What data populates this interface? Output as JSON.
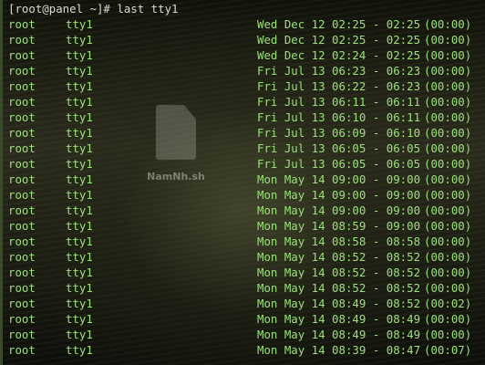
{
  "terminal": {
    "prompt": "[root@panel ~]# ",
    "command": "last tty1",
    "watermark": "NamNh.sh"
  },
  "rows": [
    {
      "user": "root",
      "tty": "tty1",
      "time": "Wed Dec 12 02:25 - 02:25",
      "duration": "(00:00)"
    },
    {
      "user": "root",
      "tty": "tty1",
      "time": "Wed Dec 12 02:25 - 02:25",
      "duration": "(00:00)"
    },
    {
      "user": "root",
      "tty": "tty1",
      "time": "Wed Dec 12 02:24 - 02:25",
      "duration": "(00:00)"
    },
    {
      "user": "root",
      "tty": "tty1",
      "time": "Fri Jul 13 06:23 - 06:23",
      "duration": "(00:00)"
    },
    {
      "user": "root",
      "tty": "tty1",
      "time": "Fri Jul 13 06:22 - 06:23",
      "duration": "(00:00)"
    },
    {
      "user": "root",
      "tty": "tty1",
      "time": "Fri Jul 13 06:11 - 06:11",
      "duration": "(00:00)"
    },
    {
      "user": "root",
      "tty": "tty1",
      "time": "Fri Jul 13 06:10 - 06:11",
      "duration": "(00:00)"
    },
    {
      "user": "root",
      "tty": "tty1",
      "time": "Fri Jul 13 06:09 - 06:10",
      "duration": "(00:00)"
    },
    {
      "user": "root",
      "tty": "tty1",
      "time": "Fri Jul 13 06:05 - 06:05",
      "duration": "(00:00)"
    },
    {
      "user": "root",
      "tty": "tty1",
      "time": "Fri Jul 13 06:05 - 06:05",
      "duration": "(00:00)"
    },
    {
      "user": "root",
      "tty": "tty1",
      "time": "Mon May 14 09:00 - 09:00",
      "duration": "(00:00)"
    },
    {
      "user": "root",
      "tty": "tty1",
      "time": "Mon May 14 09:00 - 09:00",
      "duration": "(00:00)"
    },
    {
      "user": "root",
      "tty": "tty1",
      "time": "Mon May 14 09:00 - 09:00",
      "duration": "(00:00)"
    },
    {
      "user": "root",
      "tty": "tty1",
      "time": "Mon May 14 08:59 - 09:00",
      "duration": "(00:00)"
    },
    {
      "user": "root",
      "tty": "tty1",
      "time": "Mon May 14 08:58 - 08:58",
      "duration": "(00:00)"
    },
    {
      "user": "root",
      "tty": "tty1",
      "time": "Mon May 14 08:52 - 08:52",
      "duration": "(00:00)"
    },
    {
      "user": "root",
      "tty": "tty1",
      "time": "Mon May 14 08:52 - 08:52",
      "duration": "(00:00)"
    },
    {
      "user": "root",
      "tty": "tty1",
      "time": "Mon May 14 08:52 - 08:52",
      "duration": "(00:00)"
    },
    {
      "user": "root",
      "tty": "tty1",
      "time": "Mon May 14 08:49 - 08:52",
      "duration": "(00:02)"
    },
    {
      "user": "root",
      "tty": "tty1",
      "time": "Mon May 14 08:49 - 08:49",
      "duration": "(00:00)"
    },
    {
      "user": "root",
      "tty": "tty1",
      "time": "Mon May 14 08:49 - 08:49",
      "duration": "(00:00)"
    },
    {
      "user": "root",
      "tty": "tty1",
      "time": "Mon May 14 08:39 - 08:47",
      "duration": "(00:07)"
    }
  ]
}
